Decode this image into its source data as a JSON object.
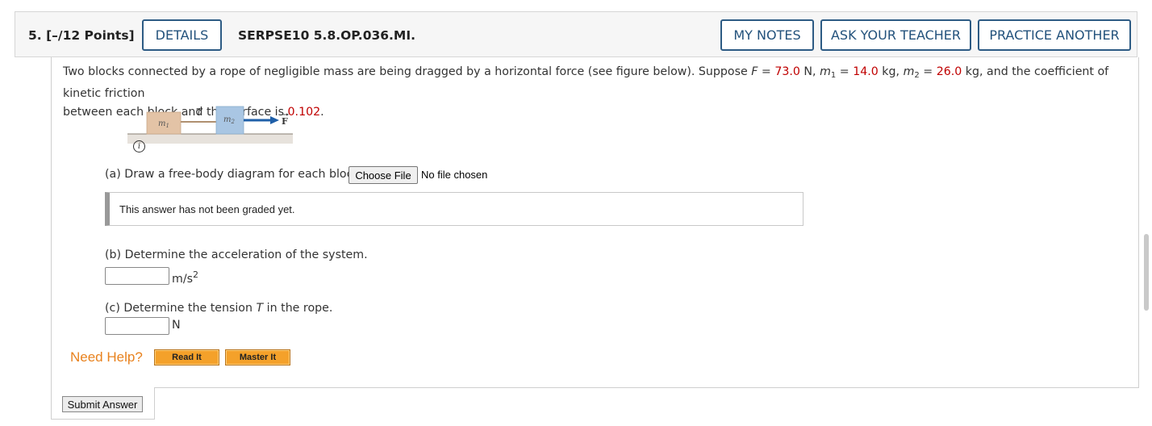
{
  "header": {
    "question_number": "5.",
    "points": "[–/12 Points]",
    "details_label": "DETAILS",
    "question_code": "SERPSE10 5.8.OP.036.MI.",
    "my_notes_label": "MY NOTES",
    "ask_teacher_label": "ASK YOUR TEACHER",
    "practice_label": "PRACTICE ANOTHER"
  },
  "problem": {
    "text_1": "Two blocks connected by a rope of negligible mass are being dragged by a horizontal force (see figure below). Suppose ",
    "F_var": "F",
    "eq": " = ",
    "F_value": "73.0",
    "F_unit": " N, ",
    "m_var": "m",
    "m1_sub": "1",
    "m1_value": "14.0",
    "m1_unit": " kg, ",
    "m2_sub": "2",
    "m2_value": "26.0",
    "m2_unit": " kg, and the coefficient of kinetic friction",
    "text_2": "between each block and the surface is ",
    "mu_value": "0.102",
    "period": "."
  },
  "figure": {
    "m1_label": "m",
    "m1_sub": "1",
    "m2_label": "m",
    "m2_sub": "2",
    "tension_label": "T",
    "force_label": "F"
  },
  "parts": {
    "a_label": "(a) Draw a free-body diagram for each block.",
    "choose_file_label": "Choose File",
    "no_file_text": "No file chosen",
    "graded_text": "This answer has not been graded yet.",
    "b_label": "(b) Determine the acceleration of the system.",
    "b_unit": "m/s",
    "b_unit_sup": "2",
    "c_label_pre": "(c) Determine the tension ",
    "c_label_var": "T",
    "c_label_post": " in the rope.",
    "c_unit": "N"
  },
  "help": {
    "label": "Need Help?",
    "read_it_label": "Read It",
    "master_it_label": "Master It"
  },
  "submit_label": "Submit Answer",
  "colors": {
    "accent": "#2d5b84",
    "given_value": "#c00000",
    "help_orange": "#e8821e",
    "block_m1": "#e3c3a6",
    "block_m2": "#a9c6e3",
    "force_arrow": "#1f5fa8"
  }
}
